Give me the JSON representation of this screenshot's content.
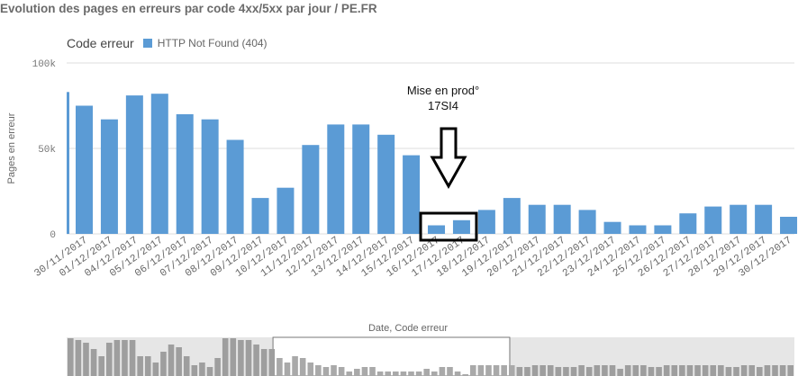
{
  "page_title": "Evolution des pages en erreurs par code 4xx/5xx par jour / PE.FR",
  "legend": {
    "title": "Code erreur",
    "entries": [
      {
        "label": "HTTP Not Found (404)",
        "color": "#5b9bd5"
      }
    ]
  },
  "annotation": {
    "line1": "Mise en prod°",
    "line2": "17SI4"
  },
  "chart_data": {
    "type": "bar",
    "title": "Evolution des pages en erreurs par code 4xx/5xx par jour / PE.FR",
    "xlabel": "Date,  Code erreur",
    "ylabel": "Pages en erreur",
    "ylim": [
      0,
      100000
    ],
    "yticks": [
      {
        "value": 0,
        "label": "0"
      },
      {
        "value": 50000,
        "label": "50k"
      },
      {
        "value": 100000,
        "label": "100k"
      }
    ],
    "grid": true,
    "legend_position": "top-left",
    "color": "#5b9bd5",
    "categories": [
      "30/11/2017",
      "01/12/2017",
      "04/12/2017",
      "05/12/2017",
      "06/12/2017",
      "07/12/2017",
      "08/12/2017",
      "09/12/2017",
      "10/12/2017",
      "11/12/2017",
      "12/12/2017",
      "13/12/2017",
      "14/12/2017",
      "15/12/2017",
      "16/12/2017",
      "17/12/2017",
      "18/12/2017",
      "19/12/2017",
      "20/12/2017",
      "21/12/2017",
      "22/12/2017",
      "23/12/2017",
      "24/12/2017",
      "25/12/2017",
      "26/12/2017",
      "27/12/2017",
      "28/12/2017",
      "29/12/2017",
      "30/12/2017"
    ],
    "series": [
      {
        "name": "HTTP Not Found (404)",
        "values": [
          75000,
          67000,
          81000,
          82000,
          70000,
          67000,
          55000,
          21000,
          27000,
          52000,
          64000,
          64000,
          58000,
          46000,
          5000,
          8000,
          14000,
          21000,
          17000,
          17000,
          14000,
          7000,
          5000,
          5000,
          12000,
          16000,
          17000,
          17000,
          10000
        ]
      }
    ],
    "partial_bars": {
      "left_value": 83000,
      "right_value": 10000
    },
    "highlighted_categories": [
      "16/12/2017",
      "17/12/2017"
    ],
    "overview": {
      "values": [
        42,
        40,
        37,
        30,
        22,
        37,
        40,
        40,
        40,
        22,
        22,
        15,
        27,
        35,
        32,
        22,
        12,
        15,
        10,
        20,
        42,
        42,
        40,
        40,
        35,
        30,
        30,
        20,
        15,
        22,
        20,
        15,
        12,
        10,
        12,
        10,
        5,
        8,
        10,
        10,
        5,
        5,
        5,
        5,
        5,
        5,
        8,
        5,
        10,
        10,
        5,
        2,
        12,
        12,
        12,
        12,
        12,
        12,
        10,
        10,
        12,
        12,
        12,
        10,
        10,
        10,
        12,
        10,
        12,
        12,
        12,
        8,
        12,
        12,
        12,
        10,
        10,
        12,
        12,
        12,
        12,
        12,
        12,
        12,
        12,
        10,
        10,
        12,
        12,
        10,
        12,
        12,
        12,
        12
      ],
      "selected_range": [
        27,
        57
      ]
    }
  }
}
